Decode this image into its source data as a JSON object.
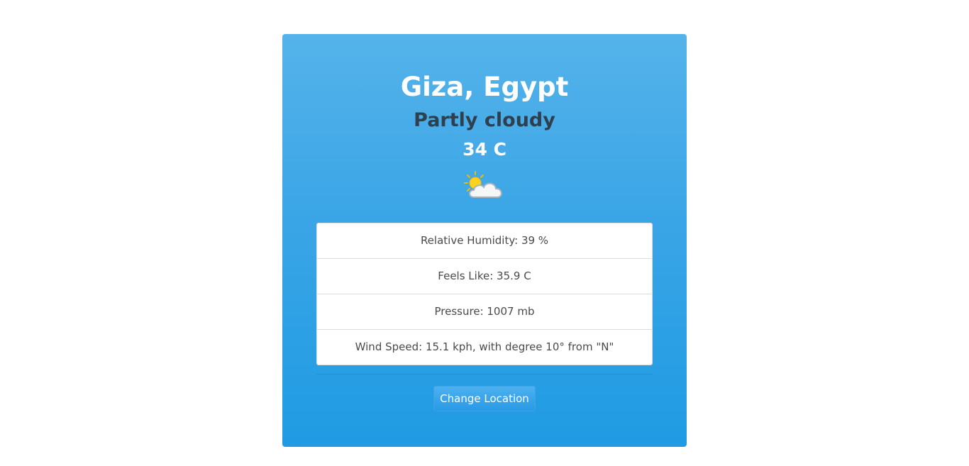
{
  "weather": {
    "location": "Giza, Egypt",
    "condition": "Partly cloudy",
    "temperature": "34 C",
    "icon": "partly-cloudy-icon"
  },
  "details": [
    {
      "text": "Relative Humidity: 39 %"
    },
    {
      "text": "Feels Like: 35.9 C"
    },
    {
      "text": "Pressure: 1007 mb"
    },
    {
      "text": "Wind Speed: 15.1 kph, with degree 10° from \"N\""
    }
  ],
  "actions": {
    "change_location_label": "Change Location"
  },
  "colors": {
    "card_gradient_top": "#55b3ea",
    "card_gradient_bottom": "#1f9be3",
    "condition_text": "#2f3f4e",
    "button": "#2a9ae6"
  }
}
